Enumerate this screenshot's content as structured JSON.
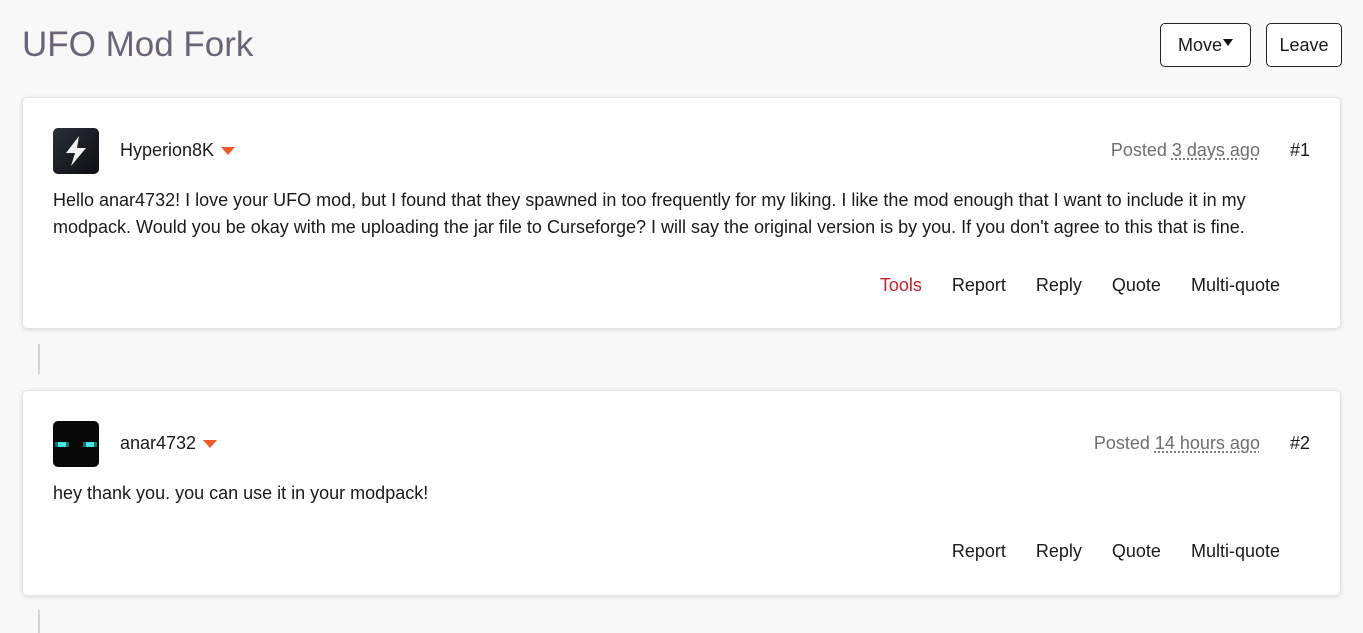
{
  "header": {
    "title": "UFO Mod Fork",
    "move_label": "Move",
    "leave_label": "Leave"
  },
  "posts": [
    {
      "username": "Hyperion8K",
      "posted_label": "Posted",
      "time": "3 days ago",
      "number": "#1",
      "body": "Hello anar4732! I love your UFO mod, but I found that they spawned in too frequently for my liking. I like the mod enough that I want to include it in my modpack. Would you be okay with me uploading the jar file to Curseforge? I will say the original version is by you. If you don't agree to this that is fine.",
      "actions": [
        "Tools",
        "Report",
        "Reply",
        "Quote",
        "Multi-quote"
      ]
    },
    {
      "username": "anar4732",
      "posted_label": "Posted",
      "time": "14 hours ago",
      "number": "#2",
      "body": "hey thank you. you can use it in your modpack!",
      "actions": [
        "Report",
        "Reply",
        "Quote",
        "Multi-quote"
      ]
    }
  ],
  "colors": {
    "accent_caret": "#f05a28",
    "tools_link": "#c4212a",
    "title": "#6b6478"
  },
  "icons": {
    "avatar_1": "lightning-bolt-icon",
    "avatar_2": "enderman-face-icon"
  }
}
